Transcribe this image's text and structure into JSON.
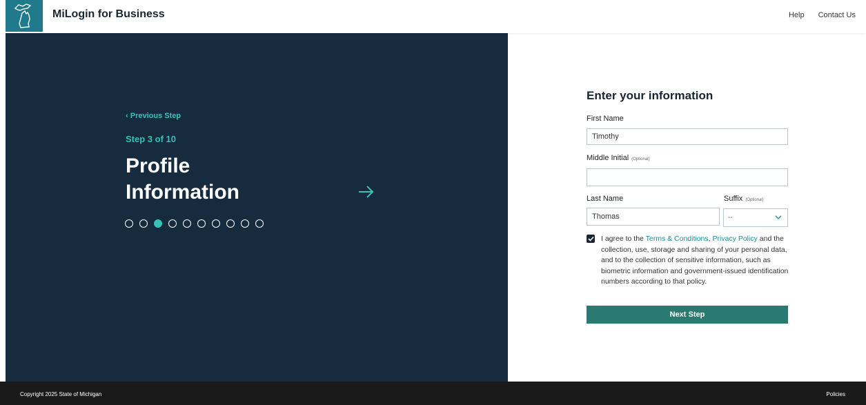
{
  "header": {
    "brand": "MiLogin for Business",
    "links": [
      "Help",
      "Contact Us"
    ]
  },
  "left": {
    "previous_step": "Previous Step",
    "step_label": "Step 3 of 10",
    "title_line1": "Profile",
    "title_line2": "Information",
    "progress": {
      "current": 3,
      "total": 10
    }
  },
  "form": {
    "title": "Enter your information",
    "first_name": {
      "label": "First Name",
      "value": "Timothy"
    },
    "middle_initial": {
      "label": "Middle Initial",
      "optional": "(Optional)",
      "value": ""
    },
    "last_name": {
      "label": "Last Name",
      "value": "Thomas"
    },
    "suffix": {
      "label": "Suffix",
      "optional": "(Optional)",
      "value": "--"
    },
    "agreement": {
      "checked": true,
      "prefix": "I agree to the ",
      "terms_link": "Terms & Conditions",
      "sep": ", ",
      "privacy_link": "Privacy Policy",
      "suffix": " and the collection, use, storage and sharing of your personal data, and to the collection of sensitive information, such as biometric information and government-issued identification numbers according to that policy."
    },
    "next_button": "Next Step"
  },
  "footer": {
    "copyright": "Copyright 2025 State of Michigan",
    "policies": "Policies"
  },
  "colors": {
    "left_panel": "#172b3f",
    "accent": "#36c2b4",
    "button": "#2a7a72",
    "link": "#1f8a93"
  }
}
